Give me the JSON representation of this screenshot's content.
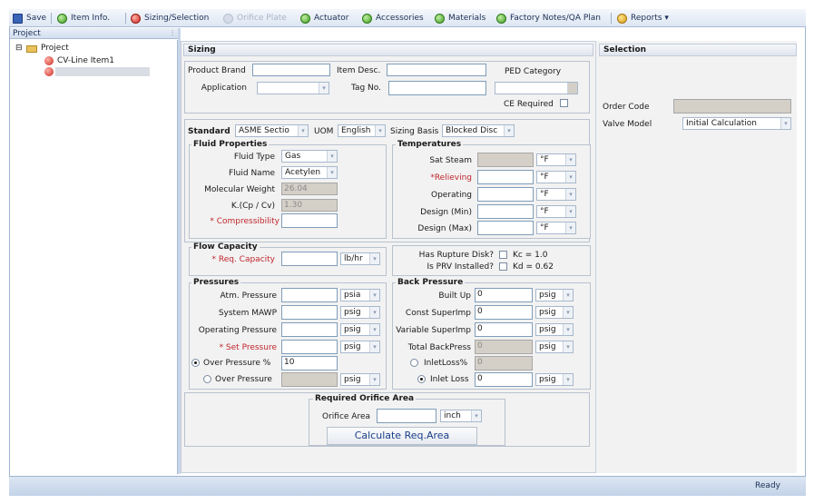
{
  "toolbar": {
    "save": "Save",
    "item_info": "Item Info.",
    "sizing_selection": "Sizing/Selection",
    "orifice_plate": "Orifice Plate",
    "actuator": "Actuator",
    "accessories": "Accessories",
    "materials": "Materials",
    "factory_notes": "Factory Notes/QA Plan",
    "reports": "Reports ▾"
  },
  "project_panel": {
    "title": "Project",
    "pin": "⫶",
    "tree": {
      "root": "Project",
      "item1": "CV-Line Item1"
    }
  },
  "sizing": {
    "header": "Sizing",
    "product_brand_label": "Product Brand",
    "item_desc_label": "Item Desc.",
    "ped_category_label": "PED Category",
    "application_label": "Application",
    "tag_no_label": "Tag No.",
    "ce_required_label": "CE Required",
    "standard_label": "Standard",
    "standard_value": "ASME Sectio",
    "uom_label": "UOM",
    "uom_value": "English",
    "sizing_basis_label": "Sizing Basis",
    "sizing_basis_value": "Blocked Disc"
  },
  "fluid_properties": {
    "legend": "Fluid Properties",
    "fluid_type_label": "Fluid Type",
    "fluid_type_value": "Gas",
    "fluid_name_label": "Fluid Name",
    "fluid_name_value": "Acetylen",
    "mol_weight_label": "Molecular Weight",
    "mol_weight_value": "26.04",
    "k_label": "K.(Cp / Cv)",
    "k_value": "1.30",
    "compressibility_label": "* Compressibility"
  },
  "temperatures": {
    "legend": "Temperatures",
    "sat_steam_label": "Sat Steam",
    "relieving_label": "*Relieving",
    "operating_label": "Operating",
    "design_min_label": "Design (Min)",
    "design_max_label": "Design (Max)",
    "unit": "°F"
  },
  "flow_capacity": {
    "legend": "Flow Capacity",
    "req_capacity_label": "* Req. Capacity",
    "unit": "lb/hr",
    "rupture_disk_label": "Has Rupture Disk?",
    "kc_label": "Kc = 1.0",
    "prv_installed_label": "Is PRV Installed?",
    "kd_label": "Kd = 0.62"
  },
  "pressures": {
    "legend": "Pressures",
    "atm_label": "Atm. Pressure",
    "atm_unit": "psia",
    "mawp_label": "System MAWP",
    "operating_label": "Operating Pressure",
    "set_label": "* Set Pressure",
    "over_pct_label": "Over Pressure %",
    "over_pct_value": "10",
    "over_label": "Over Pressure",
    "unit": "psig"
  },
  "back_pressure": {
    "legend": "Back Pressure",
    "built_up_label": "Built Up",
    "const_label": "Const SuperImp",
    "variable_label": "Variable SuperImp",
    "total_label": "Total BackPress",
    "inlet_loss_pct_label": "InletLoss%",
    "inlet_loss_label": "Inlet Loss",
    "zero": "0",
    "unit": "psig"
  },
  "orifice": {
    "legend": "Required Orifice Area",
    "area_label": "Orifice Area",
    "unit": "inch",
    "button": "Calculate Req.Area"
  },
  "selection": {
    "header": "Selection",
    "order_code_label": "Order Code",
    "valve_model_label": "Valve Model",
    "valve_model_value": "Initial Calculation"
  },
  "status": {
    "text": "Ready"
  },
  "icons": {
    "dropdown": "▾",
    "tree_collapse": "⊟"
  }
}
